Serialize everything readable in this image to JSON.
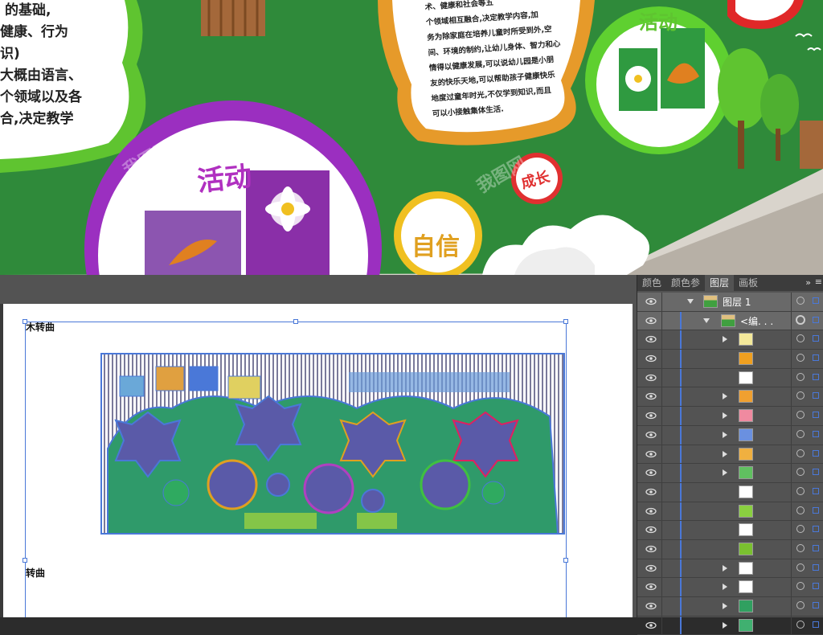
{
  "photo": {
    "left_text_lines": [
      "的基础,",
      "健康、行为",
      "识)",
      "大概由语言、",
      "个领域以及各",
      "合,决定教学"
    ],
    "mid_text_lines": [
      "术、健康和社会等五",
      "个领域相互融合,决定教学内容,加",
      "务为除家庭在培养儿童时所受到外,空",
      "间、环境的制约,让幼儿身体、智力和心",
      "情得以健康发展,可以说幼儿园是小朋",
      "友的快乐天地,可以帮助孩子健康快乐",
      "地度过童年时光,不仅学到知识,而且",
      "可以小接触集体生活."
    ],
    "badge_activity": "活动",
    "badge_confidence": "自信",
    "badge_growth": "成长",
    "badge_activity_right": "活动"
  },
  "artboard": {
    "label_top": "木转曲",
    "label_bottom": "转曲"
  },
  "panel": {
    "tabs": [
      "颜色",
      "颜色参",
      "图层",
      "画板"
    ],
    "active_tab": "图层",
    "menu_icon": "»",
    "close_icon": "≡",
    "layers": [
      {
        "name": "图层 1",
        "indent": 0,
        "expanded": true,
        "thumb": "wall"
      },
      {
        "name": "<编. . .",
        "indent": 1,
        "expanded": true,
        "thumb": "wall"
      },
      {
        "name": "",
        "indent": 2,
        "expanded": false,
        "has_children": true,
        "thumb": "yellow"
      },
      {
        "name": "",
        "indent": 2,
        "has_children": false,
        "thumb": "orange"
      },
      {
        "name": "",
        "indent": 2,
        "has_children": false,
        "thumb": "note"
      },
      {
        "name": "",
        "indent": 2,
        "has_children": true,
        "thumb": "flower"
      },
      {
        "name": "",
        "indent": 2,
        "has_children": true,
        "thumb": "pink"
      },
      {
        "name": "",
        "indent": 2,
        "has_children": true,
        "thumb": "blue"
      },
      {
        "name": "",
        "indent": 2,
        "has_children": true,
        "thumb": "orange2"
      },
      {
        "name": "",
        "indent": 2,
        "has_children": true,
        "thumb": "green"
      },
      {
        "name": "",
        "indent": 2,
        "has_children": false,
        "thumb": "blank"
      },
      {
        "name": "",
        "indent": 2,
        "has_children": false,
        "thumb": "grass"
      },
      {
        "name": "",
        "indent": 2,
        "has_children": false,
        "thumb": "blank"
      },
      {
        "name": "",
        "indent": 2,
        "has_children": false,
        "thumb": "grass2"
      },
      {
        "name": "",
        "indent": 2,
        "has_children": true,
        "thumb": "blank"
      },
      {
        "name": "",
        "indent": 2,
        "has_children": true,
        "thumb": "blank"
      },
      {
        "name": "",
        "indent": 2,
        "has_children": true,
        "thumb": "tree"
      },
      {
        "name": "",
        "indent": 2,
        "has_children": true,
        "thumb": "tree2"
      }
    ]
  },
  "colors": {
    "wall_green": "#2f8a3a",
    "purple": "#9b2fc0",
    "selection_blue": "#4a78d8",
    "panel_bg": "#535353"
  },
  "watermark_text": "我图网"
}
